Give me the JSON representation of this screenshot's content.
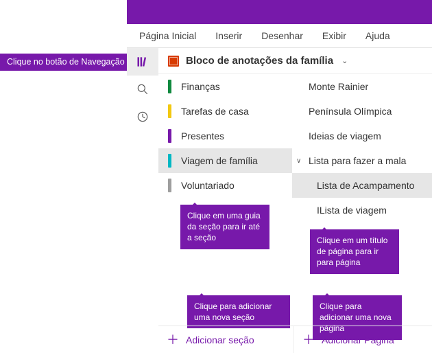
{
  "callouts": {
    "nav_button": "Clique no botão de Navegação",
    "section_tab": "Clique em uma guia da seção para ir até a seção",
    "page_title": "Clique em um título de página para ir para página",
    "add_section": "Clique para adicionar uma nova seção",
    "add_page": "Clique para adicionar uma nova página"
  },
  "ribbon": {
    "tabs": [
      "Página Inicial",
      "Inserir",
      "Desenhar",
      "Exibir",
      "Ajuda"
    ]
  },
  "notebook": {
    "title": "Bloco de anotações da família"
  },
  "sections": [
    {
      "label": "Finanças",
      "color": "#10893e",
      "selected": false
    },
    {
      "label": "Tarefas de casa",
      "color": "#f2c811",
      "selected": false
    },
    {
      "label": "Presentes",
      "color": "#7719aa",
      "selected": false
    },
    {
      "label": "Viagem de família",
      "color": "#00b7c3",
      "selected": true
    },
    {
      "label": "Voluntariado",
      "color": "#9e9e9e",
      "selected": false
    }
  ],
  "pages": [
    {
      "label": "Monte Rainier",
      "selected": false,
      "indent": false,
      "expand": ""
    },
    {
      "label": "Península Olímpica",
      "selected": false,
      "indent": false,
      "expand": ""
    },
    {
      "label": "Ideias de viagem",
      "selected": false,
      "indent": false,
      "expand": ""
    },
    {
      "label": "Lista para fazer a mala",
      "selected": false,
      "indent": false,
      "expand": "∨"
    },
    {
      "label": "Lista de Acampamento",
      "selected": true,
      "indent": true,
      "expand": ""
    },
    {
      "label": "ILista de viagem",
      "selected": false,
      "indent": true,
      "expand": ""
    }
  ],
  "footer": {
    "add_section": "Adicionar seção",
    "add_page": "Adicionar Página"
  }
}
